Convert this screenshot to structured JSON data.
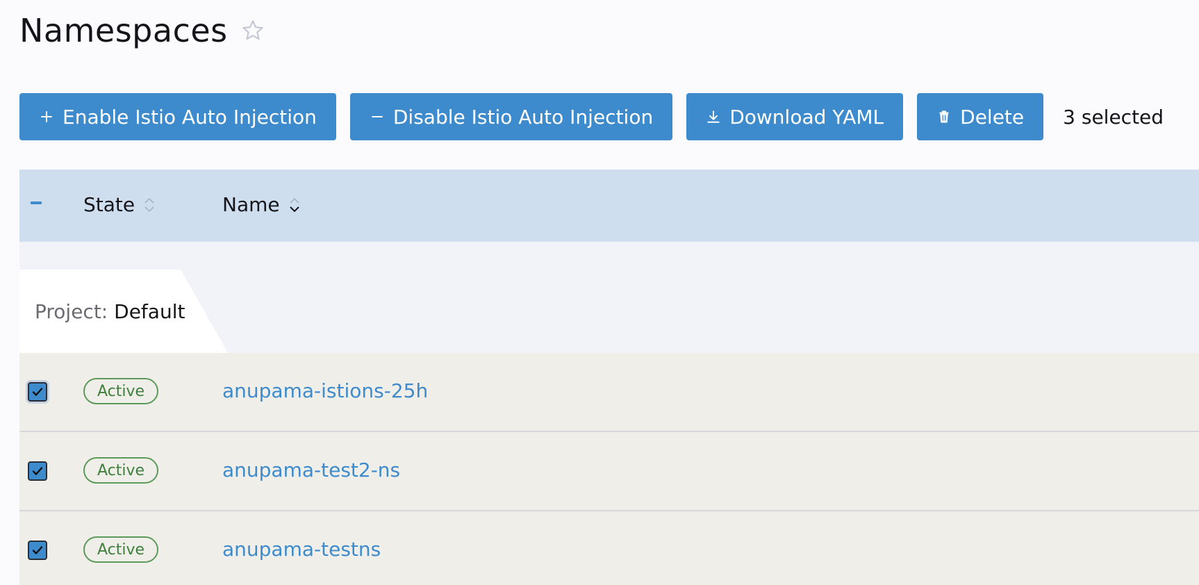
{
  "header": {
    "title": "Namespaces",
    "favorite_icon": "star-icon"
  },
  "toolbar": {
    "buttons": [
      {
        "label": "Enable Istio Auto Injection",
        "icon": "plus-icon"
      },
      {
        "label": "Disable Istio Auto Injection",
        "icon": "minus-icon"
      },
      {
        "label": "Download YAML",
        "icon": "download-icon"
      },
      {
        "label": "Delete",
        "icon": "trash-icon"
      }
    ],
    "selected_text": "3 selected"
  },
  "table": {
    "columns": [
      {
        "label": "State",
        "sort": "none"
      },
      {
        "label": "Name",
        "sort": "descending"
      }
    ],
    "select_all_state": "indeterminate",
    "group": {
      "prefix": "Project:",
      "value": "Default"
    },
    "rows": [
      {
        "state": "Active",
        "name": "anupama-istions-25h",
        "checked": true
      },
      {
        "state": "Active",
        "name": "anupama-test2-ns",
        "checked": true
      },
      {
        "state": "Active",
        "name": "anupama-testns",
        "checked": true
      }
    ]
  },
  "colors": {
    "primary": "#3d8bcd",
    "header_bg": "#cfdeef",
    "row_bg": "#efeee9",
    "active_green": "#5c9a5a"
  }
}
